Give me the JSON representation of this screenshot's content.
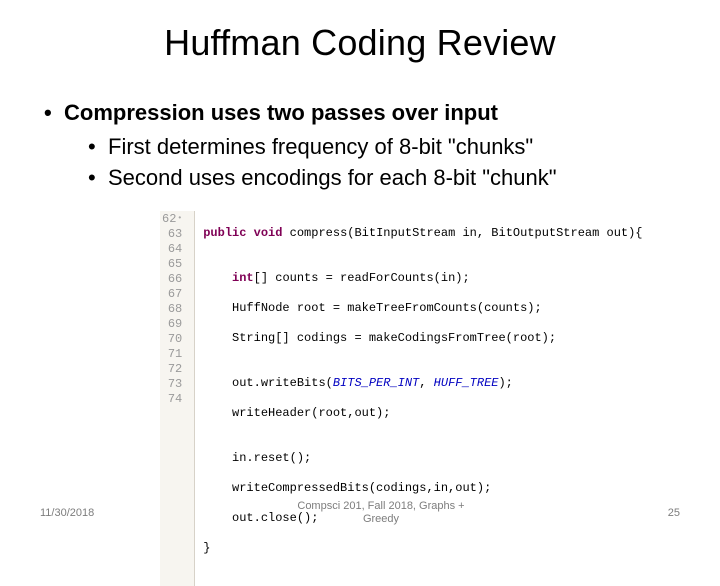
{
  "title": "Huffman Coding Review",
  "bullets": {
    "b1": "Compression uses two passes over input",
    "b2a": "First determines frequency of 8-bit \"chunks\"",
    "b2b": "Second uses encodings for each 8-bit \"chunk\""
  },
  "code": {
    "line_numbers": [
      "62",
      "63",
      "64",
      "65",
      "66",
      "67",
      "68",
      "69",
      "70",
      "71",
      "72",
      "73",
      "74"
    ],
    "lines": {
      "l62_kw1": "public",
      "l62_kw2": "void",
      "l62_rest": " compress(BitInputStream in, BitOutputStream out){",
      "l63": "",
      "l64_kw": "int",
      "l64_rest": "[] counts = readForCounts(in);",
      "l65": "    HuffNode root = makeTreeFromCounts(counts);",
      "l66": "    String[] codings = makeCodingsFromTree(root);",
      "l67": "",
      "l68_a": "    out.writeBits(",
      "l68_s1": "BITS_PER_INT",
      "l68_m": ", ",
      "l68_s2": "HUFF_TREE",
      "l68_b": ");",
      "l69": "    writeHeader(root,out);",
      "l70": "",
      "l71": "    in.reset();",
      "l72": "    writeCompressedBits(codings,in,out);",
      "l73": "    out.close();",
      "l74": "}"
    }
  },
  "footer": {
    "date": "11/30/2018",
    "mid_line1": "Compsci 201, Fall 2018,  Graphs +",
    "mid_line2": "Greedy",
    "page": "25"
  }
}
